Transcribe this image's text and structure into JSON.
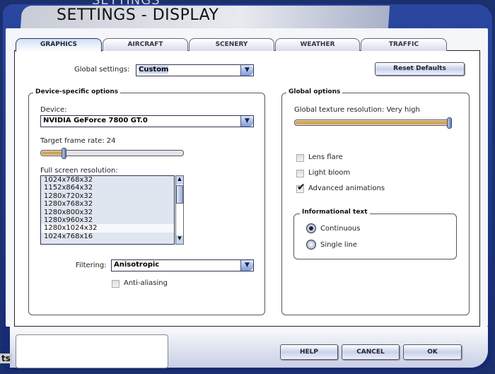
{
  "window": {
    "behind_title": "SETTINGS",
    "title": "SETTINGS - DISPLAY",
    "side_fragment": "ts"
  },
  "tabs": [
    {
      "label": "GRAPHICS",
      "active": true
    },
    {
      "label": "AIRCRAFT"
    },
    {
      "label": "SCENERY"
    },
    {
      "label": "WEATHER"
    },
    {
      "label": "TRAFFIC"
    }
  ],
  "global_settings": {
    "label": "Global settings:",
    "value": "Custom"
  },
  "reset_button": "Reset Defaults",
  "device_group": {
    "title": "Device-specific options",
    "device_label": "Device:",
    "device_value": "NVIDIA GeForce 7800 GT.0",
    "frame_rate_label": "Target frame rate: 24",
    "frame_rate_fraction": 0.15,
    "resolution_label": "Full screen resolution:",
    "resolutions": [
      "1024x768x32",
      "1152x864x32",
      "1280x720x32",
      "1280x768x32",
      "1280x800x32",
      "1280x960x32",
      "1280x1024x32",
      "1024x768x16"
    ],
    "selected_resolution": "1280x1024x32",
    "filtering_label": "Filtering:",
    "filtering_value": "Anisotropic",
    "anti_aliasing": {
      "label": "Anti-aliasing",
      "checked": false
    }
  },
  "global_group": {
    "title": "Global options",
    "texture_label": "Global texture resolution: Very high",
    "texture_fraction": 1.0,
    "checkboxes": [
      {
        "label": "Lens flare",
        "checked": false
      },
      {
        "label": "Light bloom",
        "checked": false
      },
      {
        "label": "Advanced animations",
        "checked": true
      }
    ],
    "info_title": "Informational text",
    "radios": [
      {
        "label": "Continuous",
        "selected": true
      },
      {
        "label": "Single line",
        "selected": false
      }
    ]
  },
  "buttons": {
    "help": "HELP",
    "cancel": "CANCEL",
    "ok": "OK"
  },
  "icons": {
    "dropdown": "chevron-down-icon",
    "check": "checkmark-icon"
  }
}
